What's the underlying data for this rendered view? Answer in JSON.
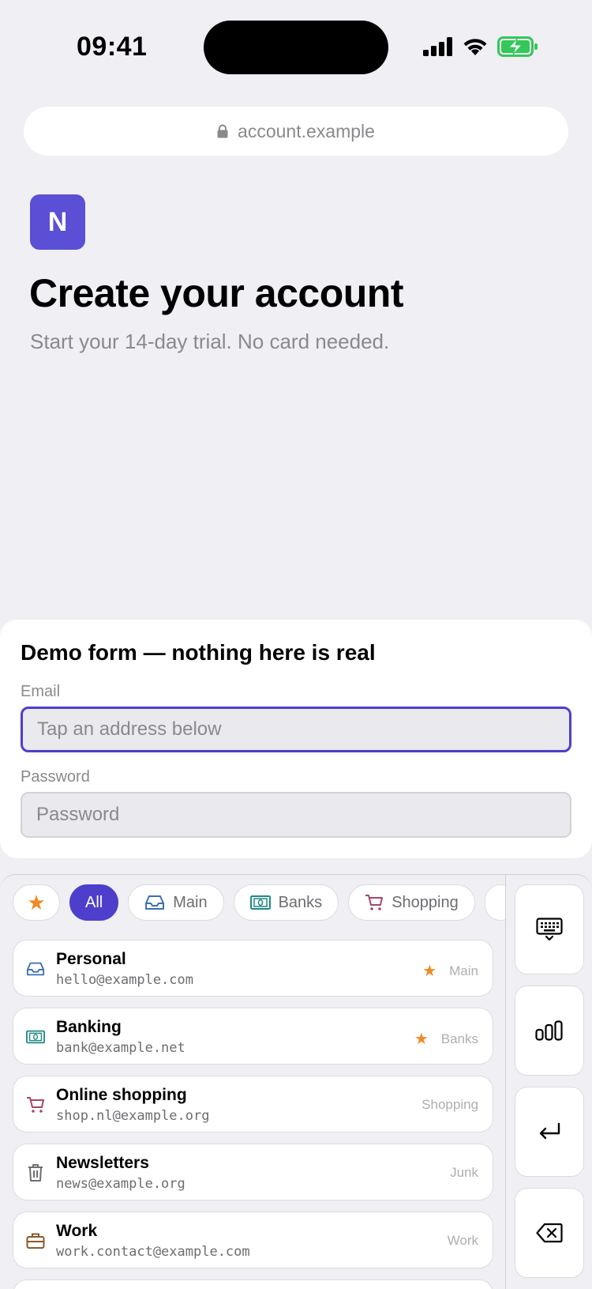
{
  "status_bar": {
    "time": "09:41",
    "icons": [
      "cellular-signal-icon",
      "wifi-icon",
      "battery-charging-icon"
    ],
    "battery_color": "#34c759"
  },
  "browser": {
    "url": "account.example",
    "lock_icon": "lock-icon"
  },
  "page": {
    "logo_letter": "N",
    "logo_color": "#5b4fd6",
    "title": "Create your account",
    "subtitle": "Start your 14-day trial. No card needed."
  },
  "form": {
    "title": "Demo form — nothing here is real",
    "email_label": "Email",
    "email_placeholder": "Tap an address below",
    "password_label": "Password",
    "password_placeholder": "Password",
    "accent_color": "#4d3fcb"
  },
  "filters": {
    "favorites_icon": "star-icon",
    "all": "All",
    "main": "Main",
    "banks": "Banks",
    "shopping": "Shopping"
  },
  "addresses": [
    {
      "name": "Personal",
      "email": "hello@example.com",
      "tag": "Main",
      "starred": true,
      "icon": "inbox-icon"
    },
    {
      "name": "Banking",
      "email": "bank@example.net",
      "tag": "Banks",
      "starred": true,
      "icon": "banknote-icon"
    },
    {
      "name": "Online shopping",
      "email": "shop.nl@example.org",
      "tag": "Shopping",
      "starred": false,
      "icon": "cart-icon"
    },
    {
      "name": "Newsletters",
      "email": "news@example.org",
      "tag": "Junk",
      "starred": false,
      "icon": "trash-icon"
    },
    {
      "name": "Work",
      "email": "work.contact@example.com",
      "tag": "Work",
      "starred": false,
      "icon": "briefcase-icon"
    }
  ],
  "side_keys": [
    "keyboard-icon",
    "number-keys-icon",
    "return-icon",
    "delete-icon"
  ],
  "star_glyph": "★"
}
